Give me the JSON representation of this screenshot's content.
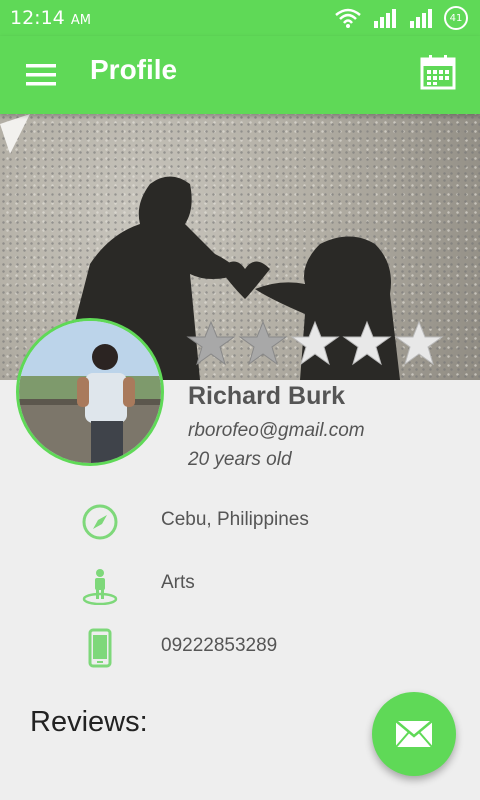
{
  "status_bar": {
    "time": "12:14",
    "ampm": "AM",
    "battery": "41"
  },
  "app_bar": {
    "title": "Profile"
  },
  "profile": {
    "name": "Richard Burk",
    "email": "rborofeo@gmail.com",
    "age": "20 years old",
    "rating": {
      "filled": 2,
      "total": 5
    }
  },
  "details": [
    {
      "icon": "compass-icon",
      "text": "Cebu, Philippines"
    },
    {
      "icon": "person-icon",
      "text": "Arts"
    },
    {
      "icon": "phone-icon",
      "text": "09222853289"
    }
  ],
  "reviews": {
    "heading": "Reviews:"
  },
  "colors": {
    "accent": "#5fd957",
    "star_filled": "#a8a8a8",
    "star_empty": "#e8e8e8",
    "text": "#555555"
  },
  "icons": [
    "menu-icon",
    "calendar-icon",
    "mail-icon",
    "wifi-icon",
    "signal-icon"
  ]
}
